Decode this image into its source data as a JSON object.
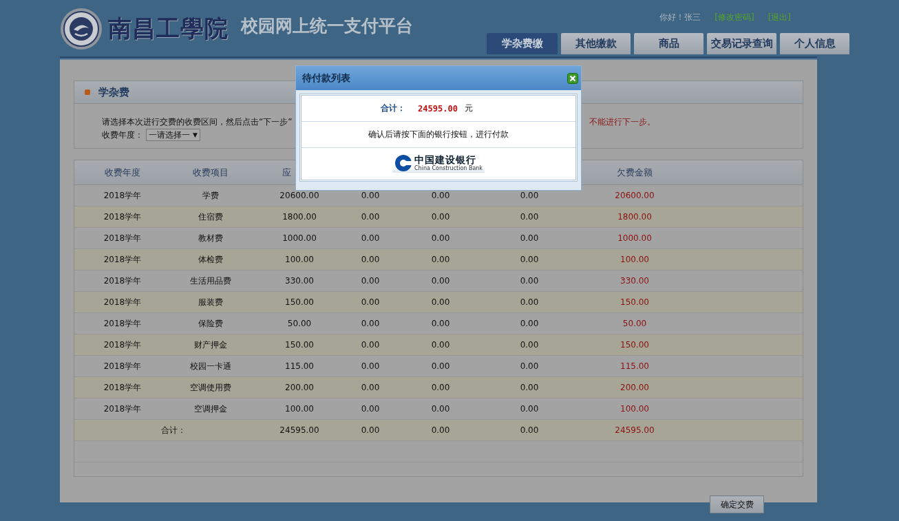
{
  "header": {
    "school_name": "南昌工學院",
    "platform_title": "校园网上统一支付平台",
    "greeting": "你好！张三",
    "links": [
      "[修改密码]",
      "[退出]"
    ]
  },
  "tabs": [
    {
      "label": "学杂费缴",
      "selected": true
    },
    {
      "label": "其他缴款",
      "selected": false
    },
    {
      "label": "商品",
      "selected": false
    },
    {
      "label": "交易记录查询",
      "selected": false
    },
    {
      "label": "个人信息",
      "selected": false
    }
  ],
  "section": {
    "title": "学杂费",
    "instruction": "请选择本次进行交费的收费区间，然后点击“下一步”",
    "instruction_tail": "不能进行下一步。",
    "year_label": "收费年度：",
    "year_select": "一请选择一",
    "year_select_caret": "▼"
  },
  "table": {
    "columns": [
      {
        "kind": "label",
        "label": "收费年度"
      },
      {
        "kind": "label",
        "label": "收费项目"
      },
      {
        "kind": "label",
        "label": "应"
      },
      {
        "kind": "covered"
      },
      {
        "kind": "covered"
      },
      {
        "kind": "covered"
      },
      {
        "kind": "label",
        "label": "欠费金额"
      }
    ],
    "rows": [
      [
        "2018学年",
        "学费",
        "20600.00",
        "0.00",
        "0.00",
        "0.00",
        "20600.00"
      ],
      [
        "2018学年",
        "住宿费",
        "1800.00",
        "0.00",
        "0.00",
        "0.00",
        "1800.00"
      ],
      [
        "2018学年",
        "教材费",
        "1000.00",
        "0.00",
        "0.00",
        "0.00",
        "1000.00"
      ],
      [
        "2018学年",
        "体检费",
        "100.00",
        "0.00",
        "0.00",
        "0.00",
        "100.00"
      ],
      [
        "2018学年",
        "生活用品费",
        "330.00",
        "0.00",
        "0.00",
        "0.00",
        "330.00"
      ],
      [
        "2018学年",
        "服装费",
        "150.00",
        "0.00",
        "0.00",
        "0.00",
        "150.00"
      ],
      [
        "2018学年",
        "保险费",
        "50.00",
        "0.00",
        "0.00",
        "0.00",
        "50.00"
      ],
      [
        "2018学年",
        "财产押金",
        "150.00",
        "0.00",
        "0.00",
        "0.00",
        "150.00"
      ],
      [
        "2018学年",
        "校园一卡通",
        "115.00",
        "0.00",
        "0.00",
        "0.00",
        "115.00"
      ],
      [
        "2018学年",
        "空调使用费",
        "200.00",
        "0.00",
        "0.00",
        "0.00",
        "200.00"
      ],
      [
        "2018学年",
        "空调押金",
        "100.00",
        "0.00",
        "0.00",
        "0.00",
        "100.00"
      ]
    ],
    "total_row": [
      "合计：",
      "24595.00",
      "0.00",
      "0.00",
      "0.00",
      "24595.00"
    ]
  },
  "dialog": {
    "title": "待付款列表",
    "total_label": "合计：",
    "total_amount": "24595.00",
    "unit": "元",
    "message": "确认后请按下面的银行按钮，进行付款",
    "bank": {
      "name": "中国建设银行",
      "name_en": "China Construction Bank"
    }
  },
  "confirm_button": "确定交费"
}
